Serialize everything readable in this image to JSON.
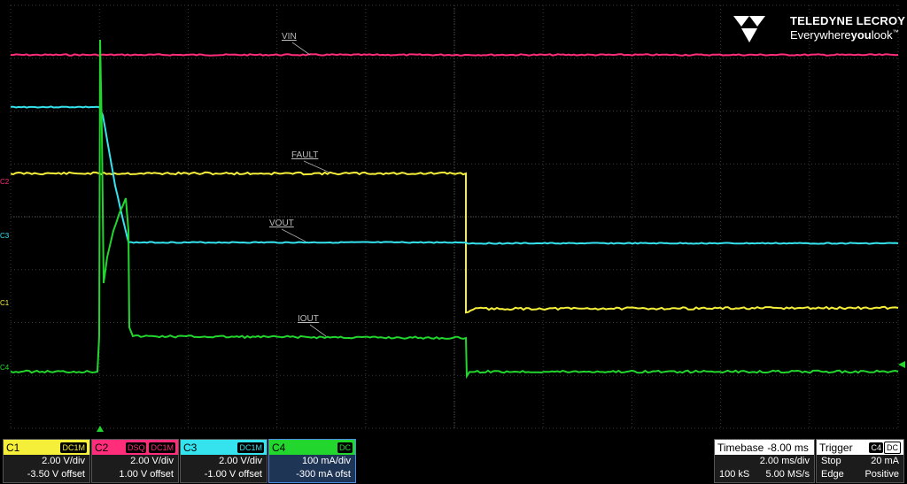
{
  "brand": {
    "name": "TELEDYNE LECROY",
    "tagline_pre": "Everywhere",
    "tagline_bold": "you",
    "tagline_post": "look",
    "tm": "™"
  },
  "traces": {
    "vin": {
      "label": "VIN",
      "color": "#ff2d7a"
    },
    "fault": {
      "label": "FAULT",
      "color": "#f5ef3a"
    },
    "vout": {
      "label": "VOUT",
      "color": "#35e3ef"
    },
    "iout": {
      "label": "IOUT",
      "color": "#22d62e"
    }
  },
  "markers": {
    "c2": "C2",
    "c3": "C3",
    "c1": "C1",
    "c4": "C4"
  },
  "channels": [
    {
      "name": "C1",
      "tags": [
        "DC1M"
      ],
      "scale": "2.00 V/div",
      "offset": "-3.50 V offset",
      "color": "#f5ef3a"
    },
    {
      "name": "C2",
      "tags": [
        "DSQ",
        "DC1M"
      ],
      "scale": "2.00 V/div",
      "offset": "1.00 V offset",
      "color": "#ff2d7a"
    },
    {
      "name": "C3",
      "tags": [
        "DC1M"
      ],
      "scale": "2.00 V/div",
      "offset": "-1.00 V offset",
      "color": "#35e3ef"
    },
    {
      "name": "C4",
      "tags": [
        "DC"
      ],
      "scale": "100 mA/div",
      "offset": "-300 mA ofst",
      "color": "#22d62e"
    }
  ],
  "timebase": {
    "label": "Timebase",
    "delay": "-8.00 ms",
    "scale": "2.00 ms/div",
    "samples": "100 kS",
    "rate": "5.00 MS/s"
  },
  "trigger": {
    "label": "Trigger",
    "source": "C4",
    "coupling": "DC",
    "mode": "Stop",
    "level": "20 mA",
    "type": "Edge",
    "slope": "Positive"
  }
}
